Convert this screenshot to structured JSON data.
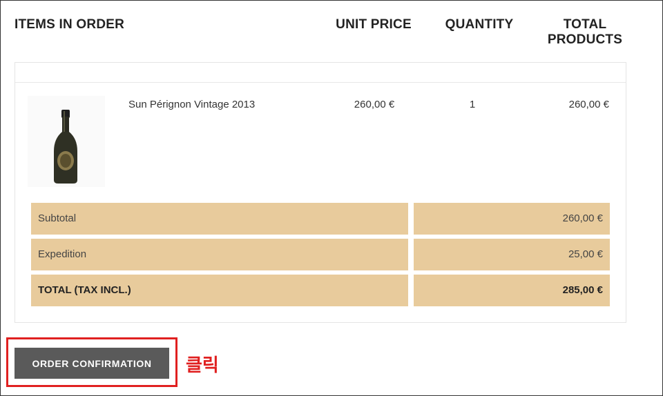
{
  "headers": {
    "items_in_order": "ITEMS IN ORDER",
    "unit_price": "UNIT PRICE",
    "quantity": "QUANTITY",
    "total_products_line1": "TOTAL",
    "total_products_line2": "PRODUCTS"
  },
  "product": {
    "name": "Sun Pérignon Vintage 2013",
    "unit_price": "260,00 €",
    "quantity": "1",
    "total": "260,00 €",
    "image_icon": "champagne-bottle-icon"
  },
  "summary": [
    {
      "label": "Subtotal",
      "value": "260,00 €"
    },
    {
      "label": "Expedition",
      "value": "25,00 €"
    },
    {
      "label": "TOTAL (TAX INCL.)",
      "value": "285,00 €"
    }
  ],
  "cta": {
    "label": "ORDER CONFIRMATION"
  },
  "annotation": {
    "text": "클릭"
  },
  "colors": {
    "summary_bg": "#e8cb9c",
    "button_bg": "#5a5a5a",
    "highlight": "#e02020"
  }
}
